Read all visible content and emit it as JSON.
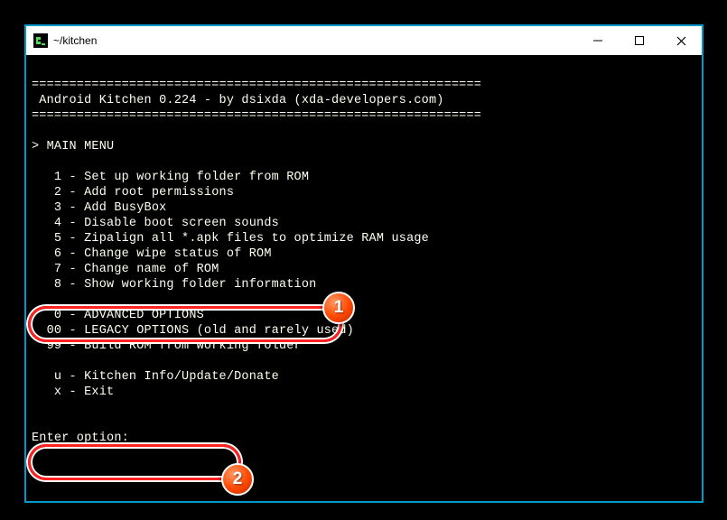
{
  "window": {
    "title": "~/kitchen"
  },
  "divider": "============================================================",
  "header": " Android Kitchen 0.224 - by dsixda (xda-developers.com)",
  "menu_title": "> MAIN MENU",
  "items": {
    "i1": "   1 - Set up working folder from ROM",
    "i2": "   2 - Add root permissions",
    "i3": "   3 - Add BusyBox",
    "i4": "   4 - Disable boot screen sounds",
    "i5": "   5 - Zipalign all *.apk files to optimize RAM usage",
    "i6": "   6 - Change wipe status of ROM",
    "i7": "   7 - Change name of ROM",
    "i8": "   8 - Show working folder information",
    "i0": "   0 - ADVANCED OPTIONS",
    "i00": "  00 - LEGACY OPTIONS (old and rarely used)",
    "i99": "  99 - Build ROM from working folder",
    "iu": "   u - Kitchen Info/Update/Donate",
    "ix": "   x - Exit"
  },
  "prompt": "Enter option:",
  "badges": {
    "b1": "1",
    "b2": "2"
  }
}
